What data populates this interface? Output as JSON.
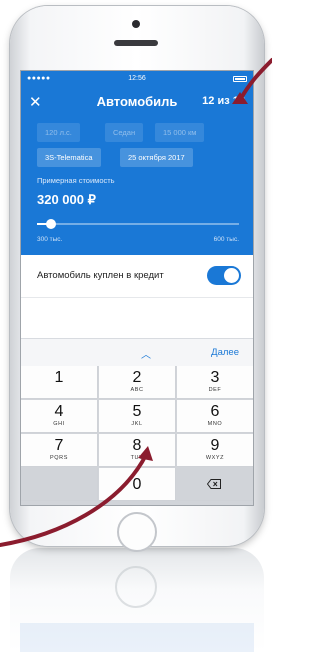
{
  "status_bar": {
    "signal": "●●●●●",
    "time": "12:56"
  },
  "nav": {
    "close_icon": "close-icon",
    "title": "Автомобиль",
    "counter": "12 из 13"
  },
  "chips": [
    {
      "label": "120 л.с."
    },
    {
      "label": "Седан"
    },
    {
      "label": "15 000 км"
    },
    {
      "label": "3S-Telematica"
    },
    {
      "label": "25 октября 2017"
    }
  ],
  "price": {
    "label": "Примерная стоимость",
    "value": "320 000 ₽",
    "min_label": "300 тыс.",
    "max_label": "600 тыс.",
    "slider_fraction": 0.067
  },
  "credit": {
    "label": "Автомобиль куплен в кредит",
    "enabled": true
  },
  "accessory": {
    "up_icon": "chevron-up-icon",
    "next_label": "Далее"
  },
  "keypad": {
    "keys": [
      {
        "digit": "1",
        "letters": ""
      },
      {
        "digit": "2",
        "letters": "ABC"
      },
      {
        "digit": "3",
        "letters": "DEF"
      },
      {
        "digit": "4",
        "letters": "GHI"
      },
      {
        "digit": "5",
        "letters": "JKL"
      },
      {
        "digit": "6",
        "letters": "MNO"
      },
      {
        "digit": "7",
        "letters": "PQRS"
      },
      {
        "digit": "8",
        "letters": "TUV"
      },
      {
        "digit": "9",
        "letters": "WXYZ"
      },
      {
        "digit": "0",
        "letters": ""
      }
    ]
  },
  "colors": {
    "accent": "#1a78d6",
    "arrow": "#8b1c2e"
  }
}
